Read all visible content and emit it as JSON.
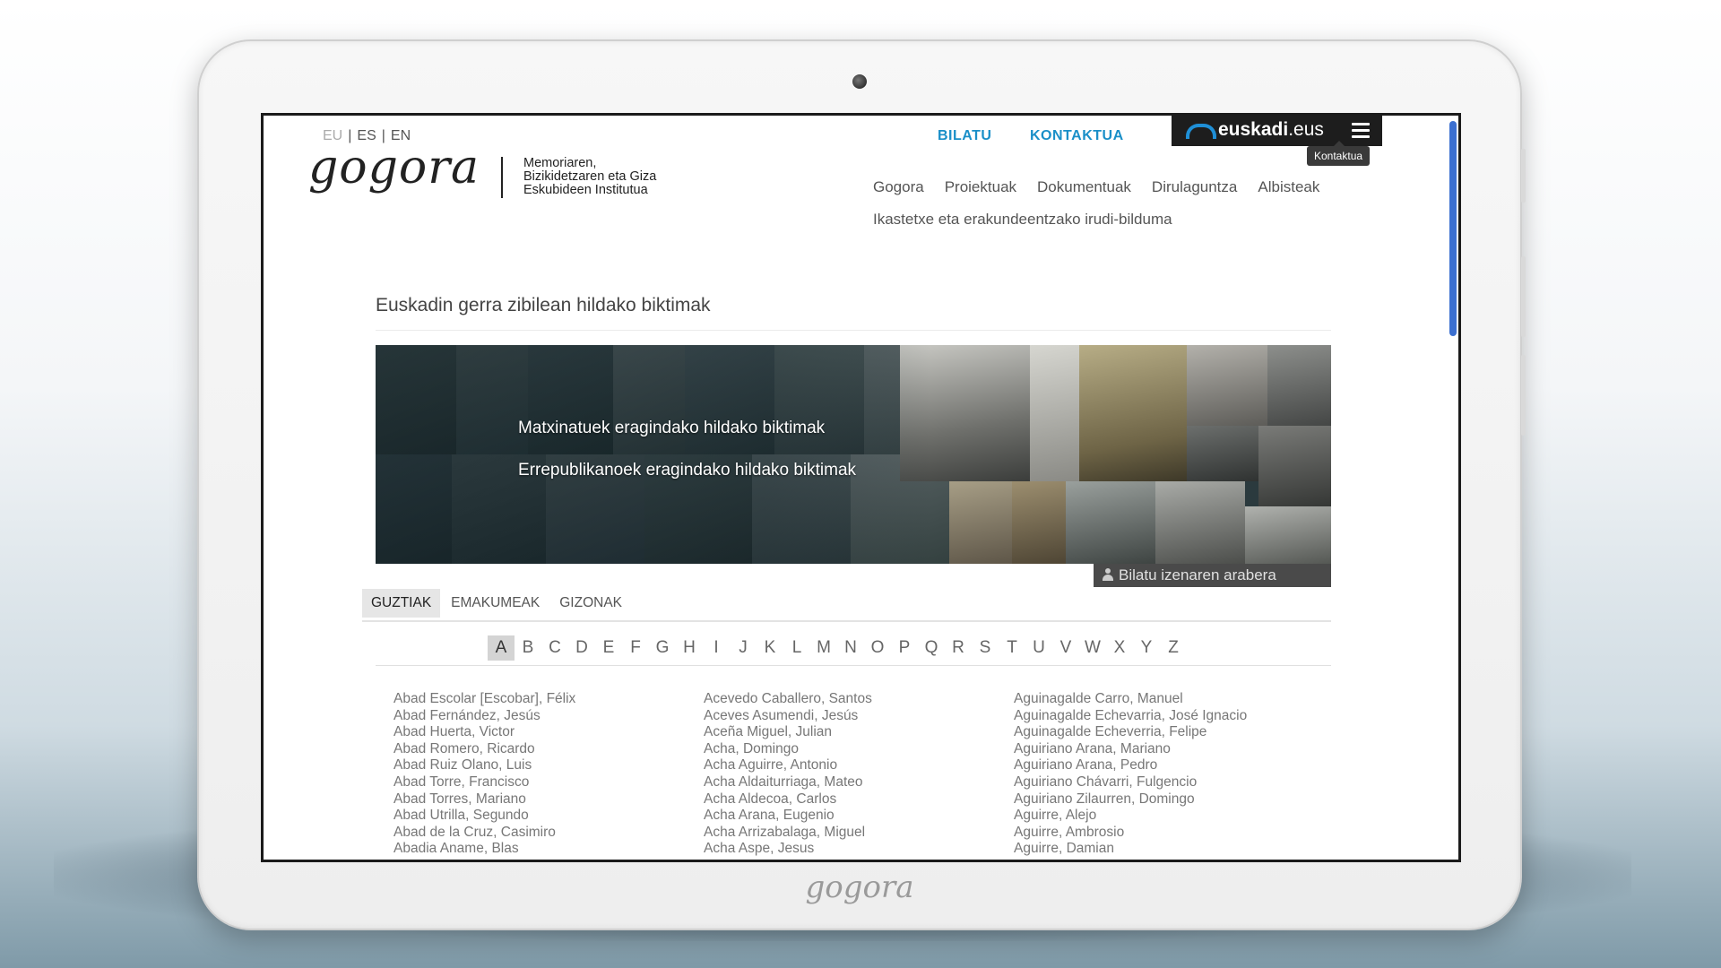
{
  "languages": [
    {
      "code": "EU",
      "active": true
    },
    {
      "code": "ES",
      "active": false
    },
    {
      "code": "EN",
      "active": false
    }
  ],
  "logo": {
    "name": "gogora",
    "tagline_line1": "Memoriaren,",
    "tagline_line2": "Bizikidetzaren eta Giza",
    "tagline_line3": "Eskubideen Institutua"
  },
  "top_links": {
    "search": "BILATU",
    "contact": "KONTAKTUA"
  },
  "euskadi_bar": {
    "brand_main": "euskadi",
    "brand_suffix": ".eus",
    "tooltip": "Kontaktua"
  },
  "nav": {
    "items": [
      "Gogora",
      "Proiektuak",
      "Dokumentuak",
      "Dirulaguntza",
      "Albisteak"
    ],
    "second_row": "Ikastetxe eta erakundeentzako irudi-bilduma"
  },
  "page_title": "Euskadin gerra zibilean hildako biktimak",
  "banner": {
    "link1": "Matxinatuek eragindako hildako biktimak",
    "link2": "Errepublikanoek eragindako hildako biktimak",
    "search_label": "Bilatu izenaren arabera"
  },
  "filters": {
    "tabs": [
      "GUZTIAK",
      "EMAKUMEAK",
      "GIZONAK"
    ],
    "active_index": 0
  },
  "alphabet": {
    "letters": [
      "A",
      "B",
      "C",
      "D",
      "E",
      "F",
      "G",
      "H",
      "I",
      "J",
      "K",
      "L",
      "M",
      "N",
      "O",
      "P",
      "Q",
      "R",
      "S",
      "T",
      "U",
      "V",
      "W",
      "X",
      "Y",
      "Z"
    ],
    "active": "A"
  },
  "names": {
    "col1": [
      "Abad Escolar [Escobar], Félix",
      "Abad Fernández, Jesús",
      "Abad Huerta, Victor",
      "Abad Romero, Ricardo",
      "Abad Ruiz Olano, Luis",
      "Abad Torre, Francisco",
      "Abad Torres, Mariano",
      "Abad Utrilla, Segundo",
      "Abad de la Cruz, Casimiro",
      "Abadia Aname, Blas"
    ],
    "col2": [
      "Acevedo Caballero, Santos",
      "Aceves Asumendi, Jesús",
      "Aceña Miguel, Julian",
      "Acha, Domingo",
      "Acha Aguirre, Antonio",
      "Acha Aldaiturriaga, Mateo",
      "Acha Aldecoa, Carlos",
      "Acha Arana, Eugenio",
      "Acha Arrizabalaga, Miguel",
      "Acha Aspe, Jesus"
    ],
    "col3": [
      "Aguinagalde Carro, Manuel",
      "Aguinagalde Echevarria, José Ignacio",
      "Aguinagalde Echeverria, Felipe",
      "Aguiriano Arana, Mariano",
      "Aguiriano Arana, Pedro",
      "Aguiriano Chávarri, Fulgencio",
      "Aguiriano Zilaurren, Domingo",
      "Aguirre, Alejo",
      "Aguirre, Ambrosio",
      "Aguirre, Damian"
    ]
  },
  "bezel_logo": "gogora",
  "colors": {
    "accent_link": "#1a8fc8",
    "euskadi_bar": "#1d1d1d",
    "euskadi_arc": "#1f8fd6",
    "scrollbar": "#3b6fd0"
  }
}
